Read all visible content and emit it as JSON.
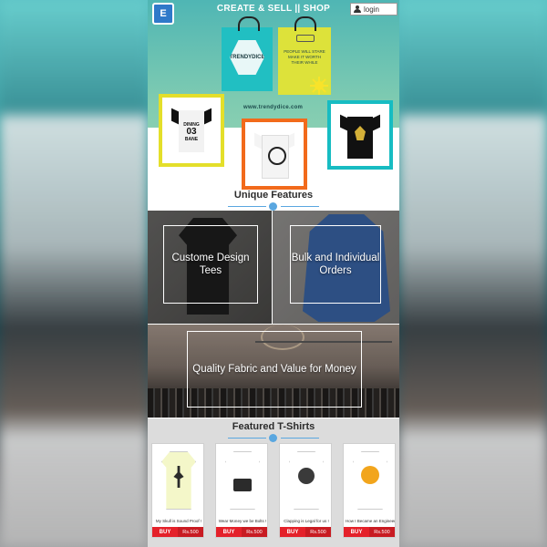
{
  "nav": {
    "logo_glyph": "E",
    "title": "CREATE & SELL  ||  SHOP",
    "login_label": "login"
  },
  "hero": {
    "bag_brand": "TRENDYDICE",
    "bag_slogan": "PEOPLE WILL STARE MAKE IT WORTH THEIR WHILE",
    "site_url": "www.trendydice.com",
    "tee_text_top": "DINING",
    "tee_number": "03",
    "tee_text_bottom": "BANE"
  },
  "sections": {
    "unique_title": "Unique Features",
    "featured_title": "Featured T-Shirts"
  },
  "features": [
    {
      "label": "Custome Design Tees"
    },
    {
      "label": "Bulk and Individual Orders"
    },
    {
      "label": "Quality Fabric and Value for Money"
    }
  ],
  "products": [
    {
      "caption": "My Skull is Sound Proof !",
      "buy": "BUY",
      "price": "Rs.500",
      "tee_color": "#f4f7c9",
      "print_color": "#2b2b2b"
    },
    {
      "caption": "Wear Money we be Bolts !",
      "buy": "BUY",
      "price": "Rs.500",
      "tee_color": "#ffffff",
      "print_color": "#2b2b2b"
    },
    {
      "caption": "Clapping is Legal for us !",
      "buy": "BUY",
      "price": "Rs.500",
      "tee_color": "#ffffff",
      "print_color": "#3a3a3a"
    },
    {
      "caption": "How I Became an Engineer !",
      "buy": "BUY",
      "price": "Rs.500",
      "tee_color": "#ffffff",
      "print_color": "#f2a51c"
    }
  ],
  "colors": {
    "accent_blue": "#5aa7e0",
    "buy_red": "#e4212a",
    "frame_yellow": "#e4df2a",
    "frame_orange": "#f26a1b",
    "frame_teal": "#17bcc2"
  }
}
